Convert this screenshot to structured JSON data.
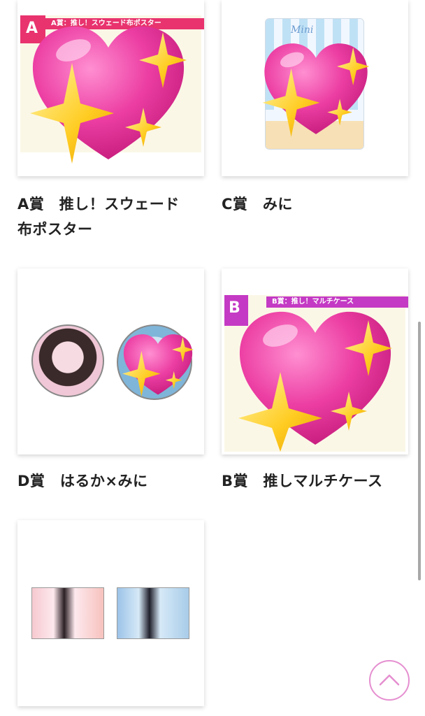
{
  "cards": [
    {
      "title_lines": [
        "A賞　推し！スウェード",
        "布ポスター"
      ],
      "banner_letter": "A",
      "banner_text": "A賞：推し！スウェード布ポスター",
      "banner_color": "#e8336e"
    },
    {
      "title_lines": [
        "C賞　みに"
      ],
      "photo_caption": "Mini"
    },
    {
      "title_lines": [
        "D賞　はるか×みに"
      ]
    },
    {
      "title_lines": [
        "B賞　推しマルチケース"
      ],
      "banner_letter": "B",
      "banner_text": "B賞：推し！マルチケース",
      "banner_color": "#c43ac4"
    },
    {
      "title_lines": []
    }
  ],
  "icons": {
    "scroll_top": "chevron-up-icon",
    "heart": "sparkling-heart-icon"
  },
  "colors": {
    "heart_pink": "#e83fa3",
    "sparkle_yellow": "#ffcf2e",
    "scroll_ring": "#e58fd0"
  }
}
